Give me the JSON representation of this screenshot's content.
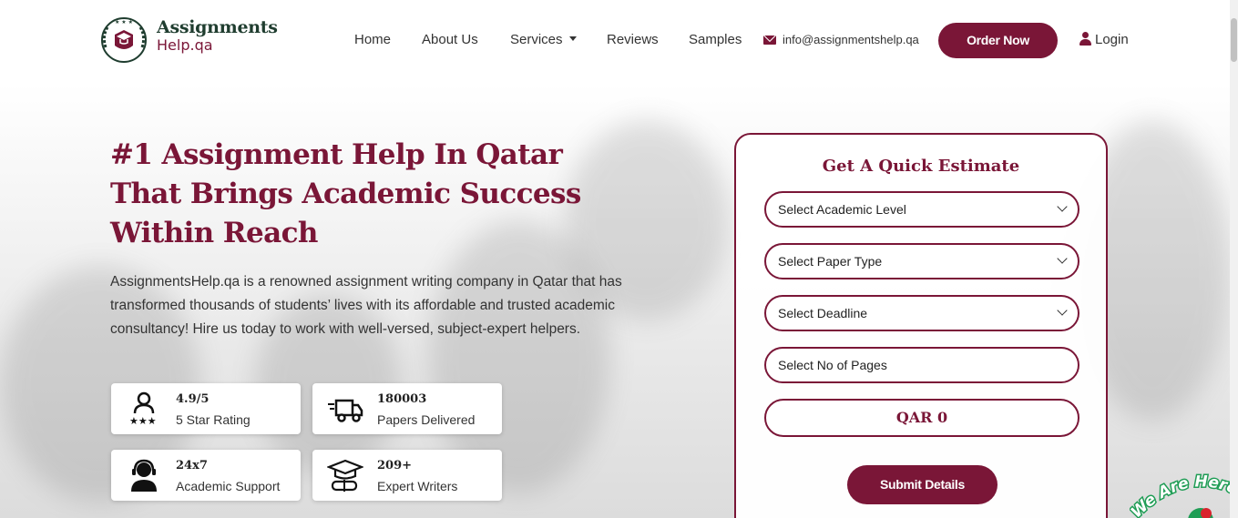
{
  "header": {
    "logo": {
      "line1": "Assignments",
      "line2": "Help.qa"
    },
    "nav": [
      {
        "label": "Home"
      },
      {
        "label": "About Us"
      },
      {
        "label": "Services"
      },
      {
        "label": "Reviews"
      },
      {
        "label": "Samples"
      }
    ],
    "email": "info@assignmentshelp.qa",
    "order_button": "Order Now",
    "login": "Login"
  },
  "hero": {
    "title_lines": [
      "#1 Assignment Help In Qatar",
      "That Brings Academic Success",
      "Within Reach"
    ],
    "description": "AssignmentsHelp.qa is a renowned assignment writing company in Qatar that has transformed thousands of students’ lives with its affordable and trusted academic consultancy! Hire us today to work with well-versed, subject-expert helpers.",
    "stats": [
      {
        "value": "4.9/5",
        "label": "5 Star Rating",
        "icon": "rating-icon"
      },
      {
        "value": "180003",
        "label": "Papers Delivered",
        "icon": "delivery-truck-icon"
      },
      {
        "value": "24x7",
        "label": "Academic Support",
        "icon": "support-agent-icon"
      },
      {
        "value": "209+",
        "label": "Expert Writers",
        "icon": "graduation-cap-icon"
      }
    ]
  },
  "estimate": {
    "title": "Get A Quick Estimate",
    "fields": [
      {
        "placeholder": "Select Academic Level"
      },
      {
        "placeholder": "Select Paper Type"
      },
      {
        "placeholder": "Select Deadline"
      },
      {
        "placeholder": "Select No of Pages"
      }
    ],
    "price": "QAR 0",
    "submit": "Submit Details"
  },
  "chat_badge": "We Are Here!",
  "colors": {
    "brand": "#7a1637",
    "logo_green": "#1f3d2f",
    "chat_green": "#1f9d55"
  }
}
